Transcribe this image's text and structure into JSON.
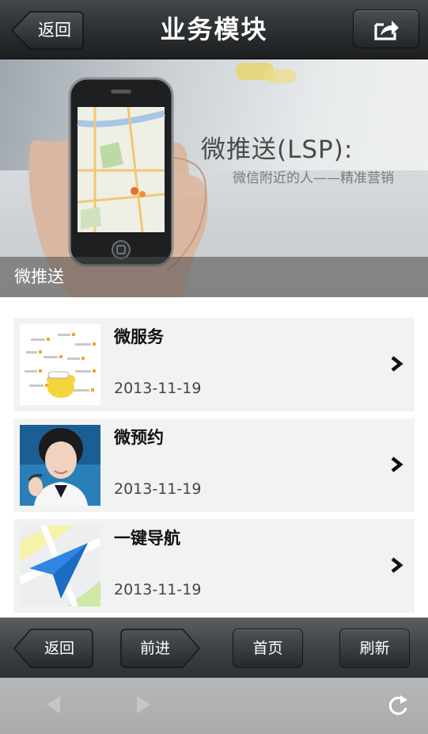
{
  "header": {
    "title": "业务模块",
    "back_label": "返回",
    "share_icon": "share-icon"
  },
  "banner": {
    "headline": "微推送(LSP):",
    "subtitle": "微信附近的人——精准营销",
    "caption": "微推送"
  },
  "list": {
    "items": [
      {
        "title": "微服务",
        "date": "2013-11-19",
        "thumb": "network-map-thumbnail"
      },
      {
        "title": "微预约",
        "date": "2013-11-19",
        "thumb": "customer-service-thumbnail"
      },
      {
        "title": "一键导航",
        "date": "2013-11-19",
        "thumb": "navigation-arrow-thumbnail"
      }
    ]
  },
  "toolbar": {
    "back_label": "返回",
    "forward_label": "前进",
    "home_label": "首页",
    "refresh_label": "刷新"
  },
  "browser": {
    "back_icon": "browser-back-icon",
    "forward_icon": "browser-forward-icon",
    "reload_icon": "reload-icon"
  }
}
